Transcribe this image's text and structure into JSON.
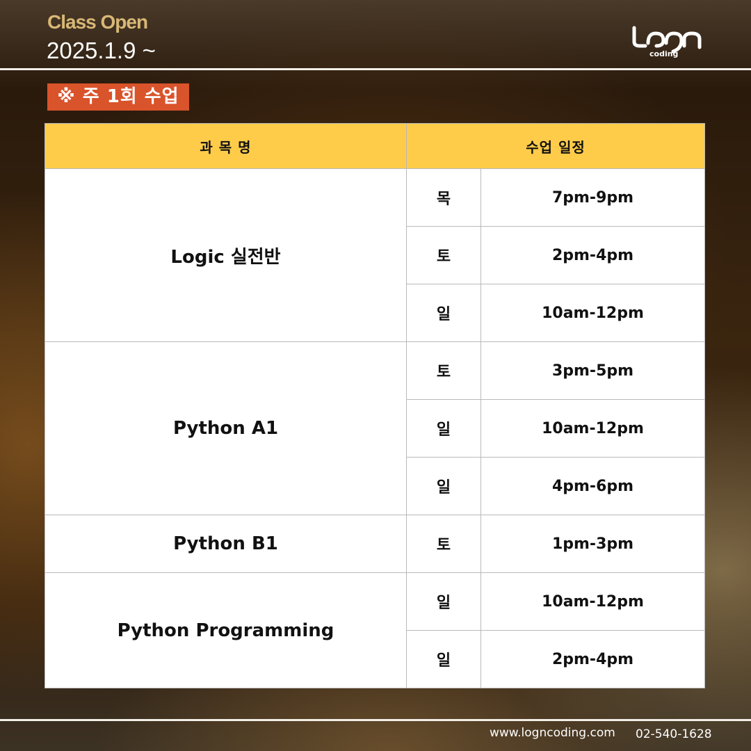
{
  "header": {
    "title": "Class Open",
    "date": "2025.1.9 ~",
    "logo_text": "coding"
  },
  "notice": "※ 주 1회 수업",
  "table": {
    "headers": [
      "과 목 명",
      "수업 일정"
    ],
    "courses": [
      {
        "name": "Logic 실전반",
        "sessions": [
          {
            "day": "목",
            "time": "7pm-9pm"
          },
          {
            "day": "토",
            "time": "2pm-4pm"
          },
          {
            "day": "일",
            "time": "10am-12pm"
          }
        ]
      },
      {
        "name": "Python A1",
        "sessions": [
          {
            "day": "토",
            "time": "3pm-5pm"
          },
          {
            "day": "일",
            "time": "10am-12pm"
          },
          {
            "day": "일",
            "time": "4pm-6pm"
          }
        ]
      },
      {
        "name": "Python B1",
        "sessions": [
          {
            "day": "토",
            "time": "1pm-3pm"
          }
        ]
      },
      {
        "name": "Python Programming",
        "sessions": [
          {
            "day": "일",
            "time": "10am-12pm"
          },
          {
            "day": "일",
            "time": "2pm-4pm"
          }
        ]
      }
    ]
  },
  "footer": {
    "url": "www.logncoding.com",
    "phone": "02-540-1628"
  },
  "colors": {
    "accent_yellow": "#ffcc4a",
    "badge_red": "#d9532b",
    "title_gold": "#d8b876"
  },
  "icons": [
    "logn-coding-logo"
  ]
}
